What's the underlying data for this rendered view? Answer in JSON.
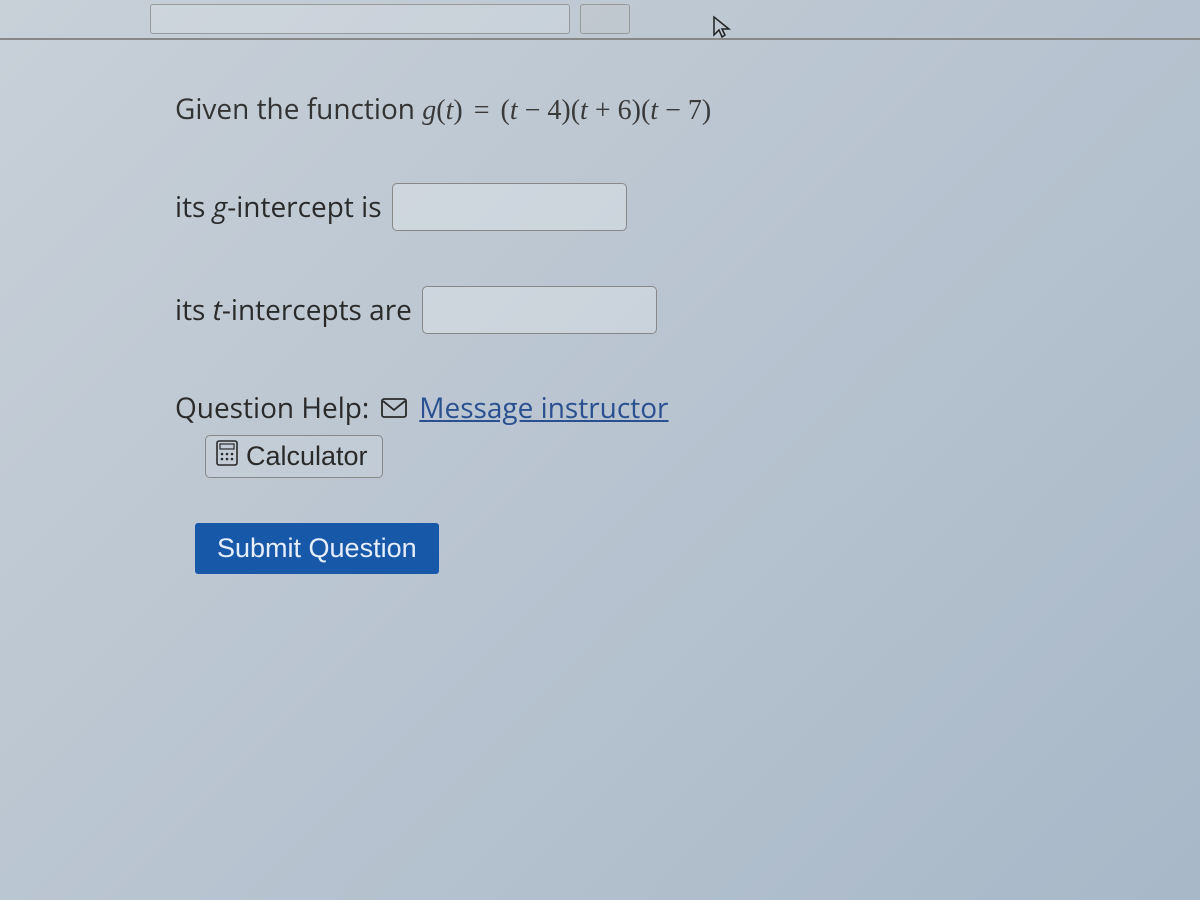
{
  "prompt": {
    "prefix": "Given the function ",
    "func_lhs_g": "g",
    "func_lhs_open": "(",
    "func_lhs_t": "t",
    "func_lhs_close": ") ",
    "equals": "=",
    "rhs_sp": " ",
    "p1_open": "(",
    "p1_t": "t",
    "p1_op": " − ",
    "p1_n": "4",
    "p1_close": ")",
    "p2_open": "(",
    "p2_t": "t",
    "p2_op": " + ",
    "p2_n": "6",
    "p2_close": ")",
    "p3_open": "(",
    "p3_t": "t",
    "p3_op": " − ",
    "p3_n": "7",
    "p3_close": ")"
  },
  "inputs": {
    "g_intercept": {
      "label_prefix": "its ",
      "label_var": "g",
      "label_suffix": "-intercept is",
      "value": ""
    },
    "t_intercepts": {
      "label_prefix": "its ",
      "label_var": "t",
      "label_suffix": "-intercepts are",
      "value": ""
    }
  },
  "help": {
    "label": "Question Help:",
    "message_link": "Message instructor",
    "calculator_label": "Calculator"
  },
  "submit": {
    "label": "Submit Question"
  }
}
